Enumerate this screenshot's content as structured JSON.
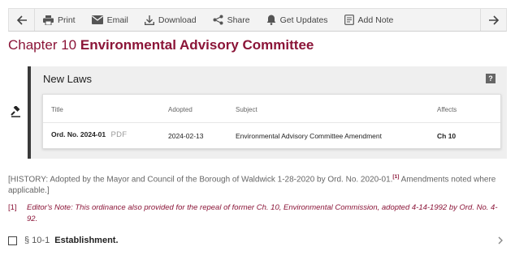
{
  "toolbar": {
    "print": "Print",
    "email": "Email",
    "download": "Download",
    "share": "Share",
    "get_updates": "Get Updates",
    "add_note": "Add Note"
  },
  "chapter": {
    "prefix": "Chapter 10",
    "name": "Environmental Advisory Committee"
  },
  "new_laws": {
    "title": "New Laws",
    "help": "?",
    "columns": [
      "Title",
      "Adopted",
      "Subject",
      "Affects"
    ],
    "rows": [
      {
        "title": "Ord. No. 2024-01",
        "pdf": "PDF",
        "adopted": "2024-02-13",
        "subject": "Environmental Advisory Committee Amendment",
        "affects": "Ch 10"
      }
    ]
  },
  "history": {
    "text_before": "[HISTORY: Adopted by the Mayor and Council of the Borough of Waldwick 1-28-2020 by Ord. No. 2020-01.",
    "footnote_ref": "[1]",
    "text_after": " Amendments noted where applicable.]"
  },
  "editor_note": {
    "marker": "[1]",
    "text": "Editor's Note: This ordinance also provided for the repeal of former Ch. 10, Environmental Commission, adopted 4-14-1992 by Ord. No. 4-92."
  },
  "section": {
    "number": "§ 10-1",
    "name": "Establishment."
  },
  "colors": {
    "accent": "#8b1538",
    "panel_border": "#3a3a3a"
  }
}
